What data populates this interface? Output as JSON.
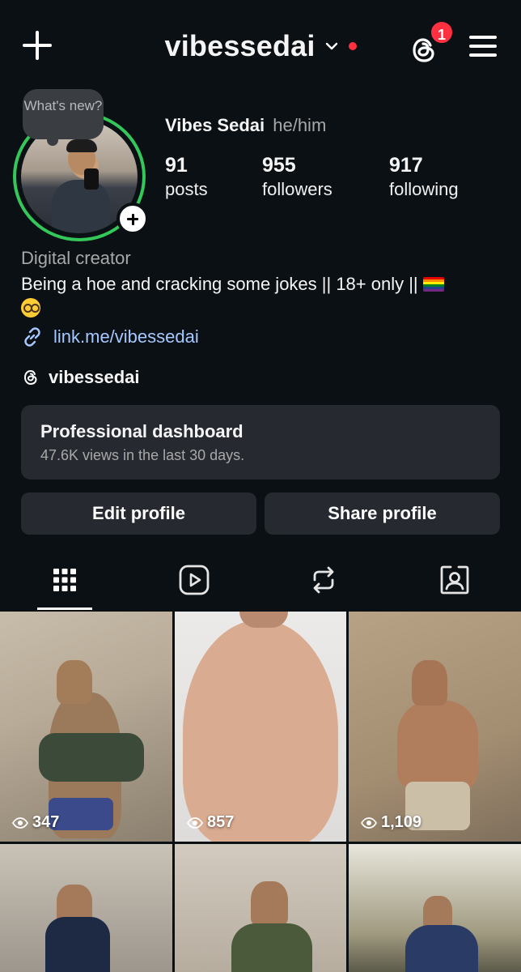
{
  "header": {
    "username": "vibessedai",
    "notification_count": "1"
  },
  "profile": {
    "note_text": "What's new?",
    "display_name": "Vibes Sedai",
    "pronouns": "he/him",
    "stats": [
      {
        "value": "91",
        "label": "posts"
      },
      {
        "value": "955",
        "label": "followers"
      },
      {
        "value": "917",
        "label": "following"
      }
    ],
    "category": "Digital creator",
    "bio": "Being a hoe and cracking some jokes || 18+ only ||",
    "link": "link.me/vibessedai",
    "threads_handle": "vibessedai"
  },
  "dashboard": {
    "title": "Professional dashboard",
    "subtitle": "47.6K views in the last 30 days."
  },
  "buttons": {
    "edit": "Edit profile",
    "share": "Share profile"
  },
  "tabs": [
    "grid-icon",
    "reels-icon",
    "reposts-icon",
    "tagged-icon"
  ],
  "posts": [
    {
      "views": "347"
    },
    {
      "views": "857"
    },
    {
      "views": "1,109"
    },
    {
      "views": ""
    },
    {
      "views": ""
    },
    {
      "views": ""
    }
  ],
  "colors": {
    "background": "#0b1014",
    "card": "#262a30",
    "story_ring": "#34c759",
    "badge": "#ff3040",
    "link": "#a5c8ff"
  }
}
